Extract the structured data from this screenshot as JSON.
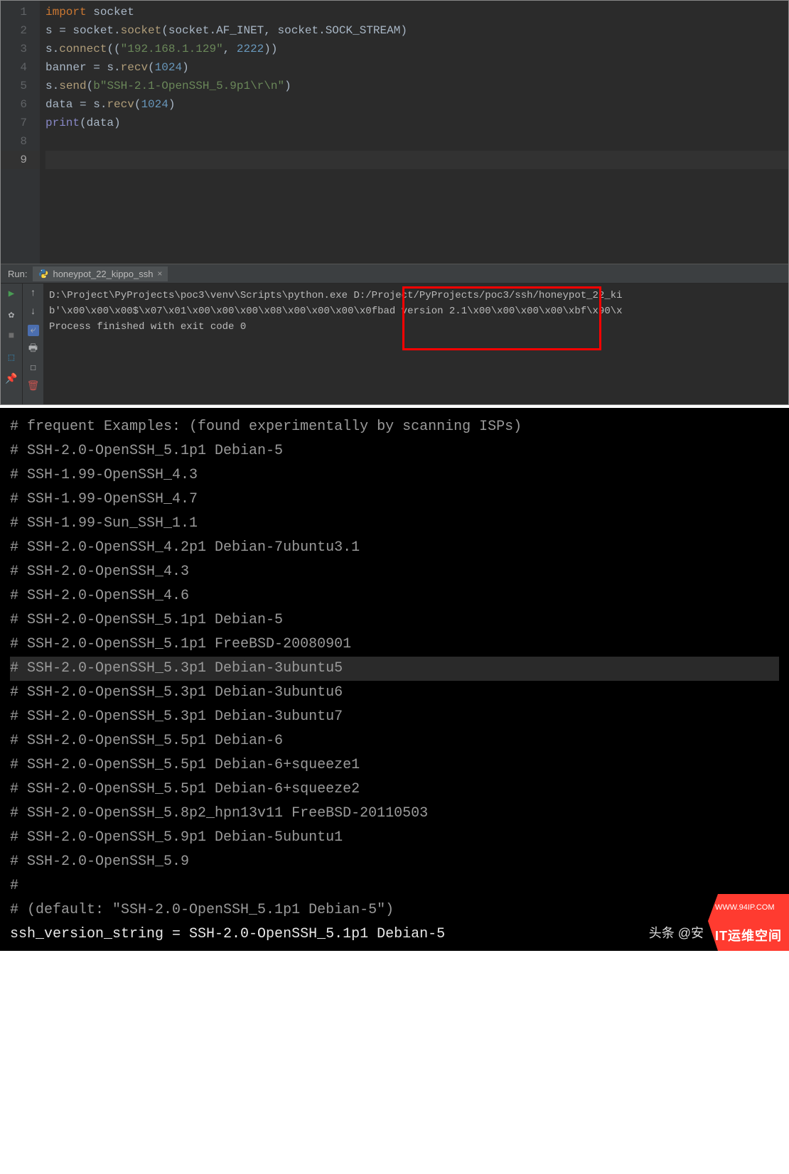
{
  "editor": {
    "lines": [
      {
        "n": "1",
        "tokens": [
          {
            "t": "import ",
            "c": "kw"
          },
          {
            "t": "socket",
            "c": "ident"
          }
        ]
      },
      {
        "n": "2",
        "tokens": [
          {
            "t": "s ",
            "c": "ident"
          },
          {
            "t": "= ",
            "c": "punct"
          },
          {
            "t": "socket",
            "c": "ident"
          },
          {
            "t": ".",
            "c": "punct"
          },
          {
            "t": "socket",
            "c": "method"
          },
          {
            "t": "(",
            "c": "punct"
          },
          {
            "t": "socket",
            "c": "ident"
          },
          {
            "t": ".",
            "c": "punct"
          },
          {
            "t": "AF_INET",
            "c": "ident"
          },
          {
            "t": ", ",
            "c": "punct"
          },
          {
            "t": "socket",
            "c": "ident"
          },
          {
            "t": ".",
            "c": "punct"
          },
          {
            "t": "SOCK_STREAM",
            "c": "ident"
          },
          {
            "t": ")",
            "c": "punct"
          }
        ]
      },
      {
        "n": "3",
        "tokens": [
          {
            "t": "s",
            "c": "ident"
          },
          {
            "t": ".",
            "c": "punct"
          },
          {
            "t": "connect",
            "c": "method"
          },
          {
            "t": "((",
            "c": "punct"
          },
          {
            "t": "\"192.168.1.129\"",
            "c": "str"
          },
          {
            "t": ", ",
            "c": "punct"
          },
          {
            "t": "2222",
            "c": "num"
          },
          {
            "t": "))",
            "c": "punct"
          }
        ]
      },
      {
        "n": "4",
        "tokens": [
          {
            "t": "banner ",
            "c": "ident"
          },
          {
            "t": "= ",
            "c": "punct"
          },
          {
            "t": "s",
            "c": "ident"
          },
          {
            "t": ".",
            "c": "punct"
          },
          {
            "t": "recv",
            "c": "method"
          },
          {
            "t": "(",
            "c": "punct"
          },
          {
            "t": "1024",
            "c": "num"
          },
          {
            "t": ")",
            "c": "punct"
          }
        ]
      },
      {
        "n": "5",
        "tokens": [
          {
            "t": "s",
            "c": "ident"
          },
          {
            "t": ".",
            "c": "punct"
          },
          {
            "t": "send",
            "c": "method"
          },
          {
            "t": "(",
            "c": "punct"
          },
          {
            "t": "b\"SSH-2.1-OpenSSH_5.9p1\\r\\n\"",
            "c": "str"
          },
          {
            "t": ")",
            "c": "punct"
          }
        ]
      },
      {
        "n": "6",
        "tokens": [
          {
            "t": "data ",
            "c": "ident"
          },
          {
            "t": "= ",
            "c": "punct"
          },
          {
            "t": "s",
            "c": "ident"
          },
          {
            "t": ".",
            "c": "punct"
          },
          {
            "t": "recv",
            "c": "method"
          },
          {
            "t": "(",
            "c": "punct"
          },
          {
            "t": "1024",
            "c": "num"
          },
          {
            "t": ")",
            "c": "punct"
          }
        ]
      },
      {
        "n": "7",
        "tokens": [
          {
            "t": "print",
            "c": "builtin"
          },
          {
            "t": "(",
            "c": "punct"
          },
          {
            "t": "data",
            "c": "ident"
          },
          {
            "t": ")",
            "c": "punct"
          }
        ]
      },
      {
        "n": "8",
        "tokens": []
      },
      {
        "n": "9",
        "tokens": [],
        "active": true
      }
    ]
  },
  "run": {
    "label": "Run:",
    "tab": "honeypot_22_kippo_ssh",
    "console": [
      "D:\\Project\\PyProjects\\poc3\\venv\\Scripts\\python.exe D:/Project/PyProjects/poc3/ssh/honeypot_22_ki",
      "b'\\x00\\x00\\x00$\\x07\\x01\\x00\\x00\\x00\\x08\\x00\\x00\\x00\\x0fbad version 2.1\\x00\\x00\\x00\\x00\\xbf\\x90\\x",
      "",
      "Process finished with exit code 0"
    ]
  },
  "comments": {
    "lines": [
      {
        "t": "# frequent Examples: (found experimentally by scanning ISPs)"
      },
      {
        "t": "# SSH-2.0-OpenSSH_5.1p1 Debian-5"
      },
      {
        "t": "# SSH-1.99-OpenSSH_4.3"
      },
      {
        "t": "# SSH-1.99-OpenSSH_4.7"
      },
      {
        "t": "# SSH-1.99-Sun_SSH_1.1"
      },
      {
        "t": "# SSH-2.0-OpenSSH_4.2p1 Debian-7ubuntu3.1"
      },
      {
        "t": "# SSH-2.0-OpenSSH_4.3"
      },
      {
        "t": "# SSH-2.0-OpenSSH_4.6"
      },
      {
        "t": "# SSH-2.0-OpenSSH_5.1p1 Debian-5"
      },
      {
        "t": "# SSH-2.0-OpenSSH_5.1p1 FreeBSD-20080901"
      },
      {
        "t": "# SSH-2.0-OpenSSH_5.3p1 Debian-3ubuntu5",
        "hl": true
      },
      {
        "t": "# SSH-2.0-OpenSSH_5.3p1 Debian-3ubuntu6"
      },
      {
        "t": "# SSH-2.0-OpenSSH_5.3p1 Debian-3ubuntu7"
      },
      {
        "t": "# SSH-2.0-OpenSSH_5.5p1 Debian-6"
      },
      {
        "t": "# SSH-2.0-OpenSSH_5.5p1 Debian-6+squeeze1"
      },
      {
        "t": "# SSH-2.0-OpenSSH_5.5p1 Debian-6+squeeze2"
      },
      {
        "t": "# SSH-2.0-OpenSSH_5.8p2_hpn13v11 FreeBSD-20110503"
      },
      {
        "t": "# SSH-2.0-OpenSSH_5.9p1 Debian-5ubuntu1"
      },
      {
        "t": "# SSH-2.0-OpenSSH_5.9"
      },
      {
        "t": "#"
      },
      {
        "t": "# (default: \"SSH-2.0-OpenSSH_5.1p1 Debian-5\")"
      }
    ],
    "assign": "ssh_version_string = SSH-2.0-OpenSSH_5.1p1 Debian-5"
  },
  "watermark": {
    "text": "头条 @安",
    "top": "WWW.94IP.COM",
    "bot": "IT运维空间"
  }
}
